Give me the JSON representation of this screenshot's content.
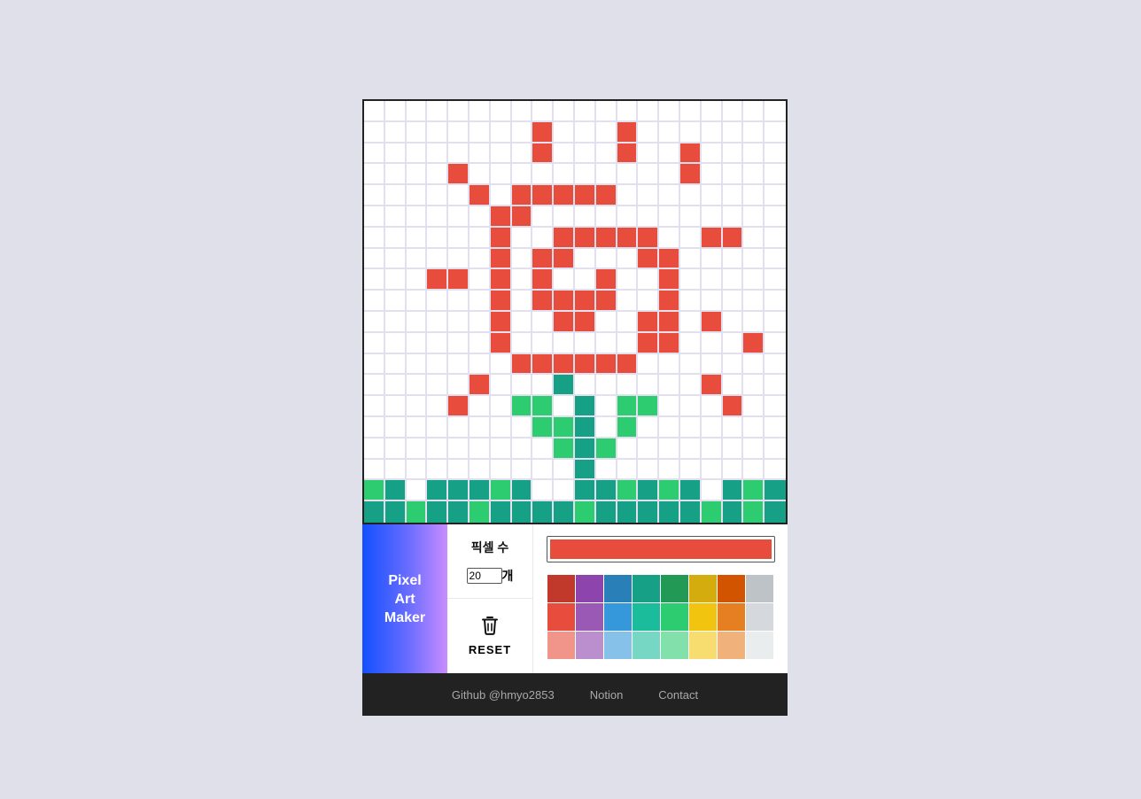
{
  "logo": {
    "line1": "Pixel",
    "line2": "Art",
    "line3": "Maker"
  },
  "settings": {
    "pixel_count_label": "픽셀 수",
    "pixel_count_value": "20",
    "pixel_count_unit": "개",
    "reset_label": "RESET",
    "reset_icon": "trash-icon"
  },
  "current_color": "#e74c3c",
  "palette": [
    "#c0392b",
    "#8e44ad",
    "#2980b9",
    "#16a085",
    "#229954",
    "#d4ac0d",
    "#d35400",
    "#bdc3c7",
    "#e74c3c",
    "#9b59b6",
    "#3498db",
    "#1abc9c",
    "#2ecc71",
    "#f1c40f",
    "#e67e22",
    "#d5d8dc",
    "#f1948a",
    "#bb8fce",
    "#85c1e9",
    "#76d7c4",
    "#82e0aa",
    "#f7dc6f",
    "#f0b27a",
    "#eaeded"
  ],
  "canvas": {
    "size": 20,
    "colors": {
      "R": "#e74c3c",
      "T": "#16a085",
      "G": "#2ecc71"
    },
    "rows": [
      "....................",
      "........R...R.......",
      "........R...R..R....",
      "....R..........R....",
      ".....R.RRRRR........",
      "......RR............",
      "......R..RRRRR..RR..",
      "......R.RR...RR.....",
      "...RR.R.R..R..R.....",
      "......R.RRRR..R.....",
      "......R..RR..RR.R...",
      "......R......RR...R.",
      ".......RRRRRR.......",
      ".....R...T......R...",
      "....R..GG.T.GG...R..",
      "........GGT.G.......",
      ".........GTG........",
      "..........T.........",
      "GT.TTTGT..TTGTGT.TGT",
      "TTGTTGTTTTGTTTTTGTGT"
    ]
  },
  "footer": {
    "links": [
      "Github @hmyo2853",
      "Notion",
      "Contact"
    ]
  }
}
